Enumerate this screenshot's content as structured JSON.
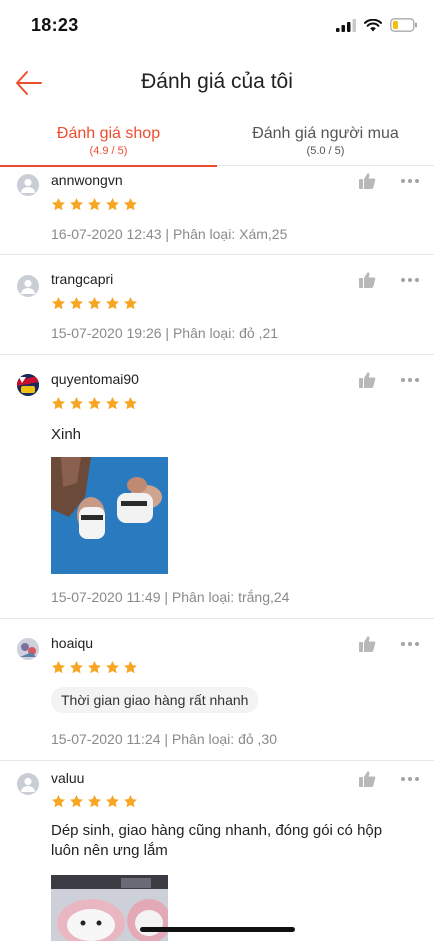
{
  "status": {
    "time": "18:23"
  },
  "nav": {
    "title": "Đánh giá của tôi"
  },
  "tabs": [
    {
      "label": "Đánh giá shop",
      "sub": "(4.9 / 5)"
    },
    {
      "label": "Đánh giá người mua",
      "sub": "(5.0 / 5)"
    }
  ],
  "reviews": [
    {
      "user": "annwongvn",
      "rating": 5,
      "meta": "16-07-2020 12:43 | Phân loại: Xám,25"
    },
    {
      "user": "trangcapri",
      "rating": 5,
      "meta": "15-07-2020 19:26 | Phân loại: đỏ ,21"
    },
    {
      "user": "quyentomai90",
      "rating": 5,
      "comment": "Xinh",
      "meta": "15-07-2020 11:49 | Phân loại: trắng,24"
    },
    {
      "user": "hoaiqu",
      "rating": 5,
      "tag": "Thời gian giao hàng rất nhanh",
      "meta": "15-07-2020 11:24 | Phân loại: đỏ ,30"
    },
    {
      "user": "valuu",
      "rating": 5,
      "comment": "Dép sinh, giao hàng cũng nhanh, đóng gói có hộp luôn nên ưng lắm"
    }
  ],
  "colors": {
    "accent": "#ee4d2d",
    "star": "#f6a623",
    "muted": "#8a8a8a"
  }
}
